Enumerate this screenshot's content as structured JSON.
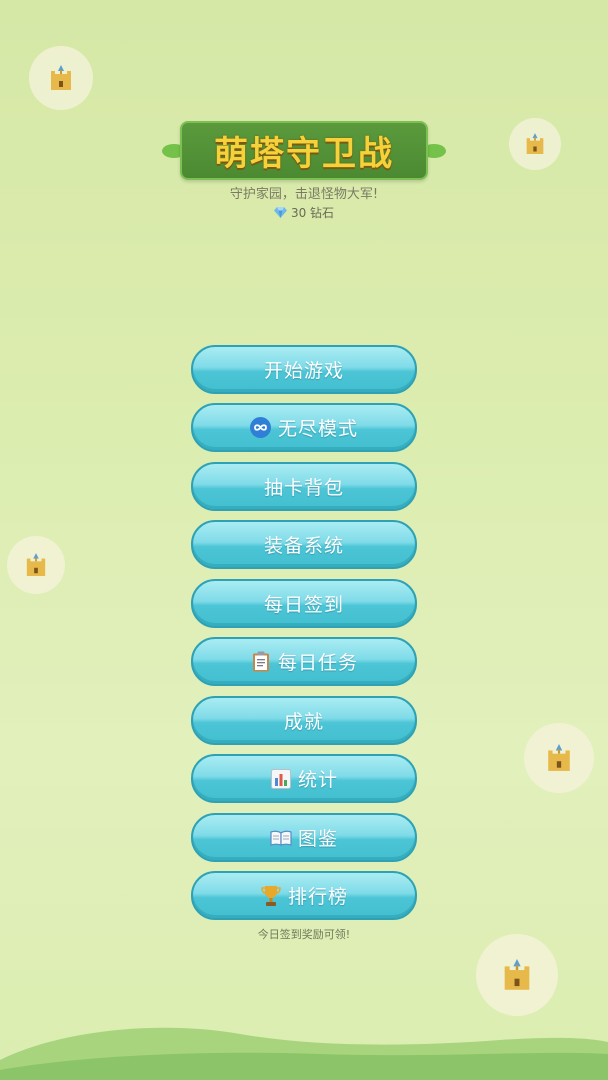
{
  "title": "萌塔守卫战",
  "subtitle": "守护家园，击退怪物大军!",
  "currency": {
    "icon": "diamond-icon",
    "amount_text": "30 钻石"
  },
  "menu": [
    {
      "label": "开始游戏",
      "icon": null
    },
    {
      "label": "无尽模式",
      "icon": "infinity-icon"
    },
    {
      "label": "抽卡背包",
      "icon": null
    },
    {
      "label": "装备系统",
      "icon": null
    },
    {
      "label": "每日签到",
      "icon": null
    },
    {
      "label": "每日任务",
      "icon": "clipboard-icon"
    },
    {
      "label": "成就",
      "icon": null
    },
    {
      "label": "统计",
      "icon": "bar-chart-icon"
    },
    {
      "label": "图鉴",
      "icon": "book-icon"
    },
    {
      "label": "排行榜",
      "icon": "trophy-icon"
    }
  ],
  "footer_note": "今日签到奖励可领!",
  "colors": {
    "background": "#dcedb0",
    "banner": "#4c8a32",
    "title_text": "#f6d23a",
    "button_fill": "#4cc5d6",
    "button_border": "#2ea2b4",
    "hills": "#8cc46a"
  },
  "decorations": [
    "castle-icon",
    "castle-icon",
    "castle-icon",
    "castle-icon",
    "castle-icon"
  ]
}
